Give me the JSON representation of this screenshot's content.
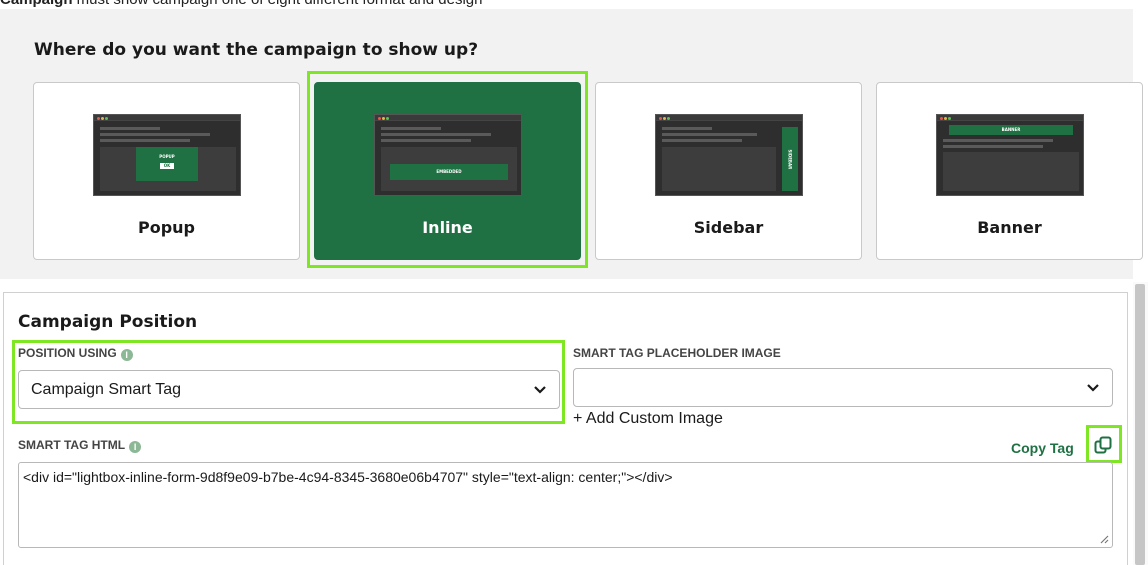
{
  "top_cut_text": {
    "bold": "Campaign",
    "rest": " must show campaign one of eight different format and design"
  },
  "question": "Where do you want the campaign to show up?",
  "cards": [
    {
      "label": "Popup",
      "thumb_text": "POPUP",
      "button_text": "OK",
      "selected": false
    },
    {
      "label": "Inline",
      "thumb_text": "EMBEDDED",
      "selected": true
    },
    {
      "label": "Sidebar",
      "thumb_text": "SIDEBAR",
      "selected": false
    },
    {
      "label": "Banner",
      "thumb_text": "BANNER",
      "selected": false
    }
  ],
  "position": {
    "title": "Campaign Position",
    "position_using_label": "POSITION USING",
    "position_using_value": "Campaign Smart Tag",
    "placeholder_label": "SMART TAG PLACEHOLDER IMAGE",
    "placeholder_value": "",
    "add_custom_image": "+ Add Custom Image",
    "smart_tag_label": "SMART TAG HTML",
    "copy_tag": "Copy Tag",
    "smart_tag_html": "<div id=\"lightbox-inline-form-9d8f9e09-b7be-4c94-8345-3680e06b4707\" style=\"text-align: center;\"></div>"
  },
  "colors": {
    "accent": "#1f7144",
    "highlight": "#7fe624",
    "info": "#8cb896"
  }
}
